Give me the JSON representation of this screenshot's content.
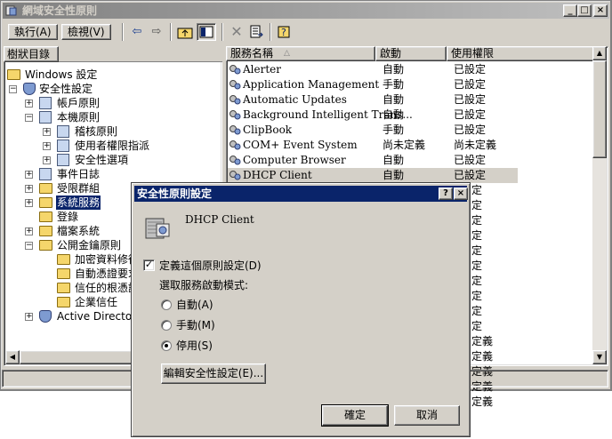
{
  "window": {
    "title": "網域安全性原則"
  },
  "menu": [
    {
      "label": "執行(A)"
    },
    {
      "label": "檢視(V)"
    }
  ],
  "tree": {
    "tab_label": "樹狀目錄",
    "items": [
      {
        "label": "Windows 設定"
      },
      {
        "label": "安全性設定"
      },
      {
        "label": "帳戶原則"
      },
      {
        "label": "本機原則"
      },
      {
        "label": "稽核原則"
      },
      {
        "label": "使用者權限指派"
      },
      {
        "label": "安全性選項"
      },
      {
        "label": "事件日誌"
      },
      {
        "label": "受限群組"
      },
      {
        "label": "系統服務"
      },
      {
        "label": "登錄"
      },
      {
        "label": "檔案系統"
      },
      {
        "label": "公開金鑰原則"
      },
      {
        "label": "加密資料修復"
      },
      {
        "label": "自動憑證要求"
      },
      {
        "label": "信任的根憑證"
      },
      {
        "label": "企業信任"
      },
      {
        "label": "Active Directory"
      }
    ]
  },
  "list": {
    "columns": [
      "服務名稱",
      "啟動",
      "使用權限"
    ],
    "rows": [
      {
        "name": "Alerter",
        "startup": "自動",
        "permission": "已設定"
      },
      {
        "name": "Application Management",
        "startup": "手動",
        "permission": "已設定"
      },
      {
        "name": "Automatic Updates",
        "startup": "自動",
        "permission": "已設定"
      },
      {
        "name": "Background Intelligent Trans...",
        "startup": "自動",
        "permission": "已設定"
      },
      {
        "name": "ClipBook",
        "startup": "手動",
        "permission": "已設定"
      },
      {
        "name": "COM+ Event System",
        "startup": "尚未定義",
        "permission": "尚未定義"
      },
      {
        "name": "Computer Browser",
        "startup": "自動",
        "permission": "已設定"
      },
      {
        "name": "DHCP Client",
        "startup": "自動",
        "permission": "已設定"
      }
    ],
    "hidden_perm_fragments": [
      "定",
      "定",
      "定",
      "定",
      "定",
      "定",
      "定",
      "定",
      "定",
      "定",
      "定義",
      "定義",
      "定義",
      "定義",
      "定義"
    ]
  },
  "dialog": {
    "title": "安全性原則設定",
    "service_name": "DHCP Client",
    "define_checkbox_label": "定義這個原則設定(D)",
    "define_checked": true,
    "mode_label": "選取服務啟動模式:",
    "options": [
      {
        "label": "自動(A)",
        "selected": false
      },
      {
        "label": "手動(M)",
        "selected": false
      },
      {
        "label": "停用(S)",
        "selected": true
      }
    ],
    "edit_button": "編輯安全性設定(E)...",
    "ok_button": "確定",
    "cancel_button": "取消",
    "help_glyph": "?",
    "close_glyph": "×"
  },
  "colors": {
    "face": "#d4d0c8",
    "title_active": "#0a246a",
    "title_inactive": "#808080",
    "selection": "#0a246a"
  },
  "icons": [
    "app-icon",
    "back-icon",
    "forward-icon",
    "up-folder-icon",
    "show-hide-tree-icon",
    "delete-icon",
    "export-list-icon",
    "help-icon",
    "folder-icon",
    "policy-icon",
    "service-icon"
  ]
}
